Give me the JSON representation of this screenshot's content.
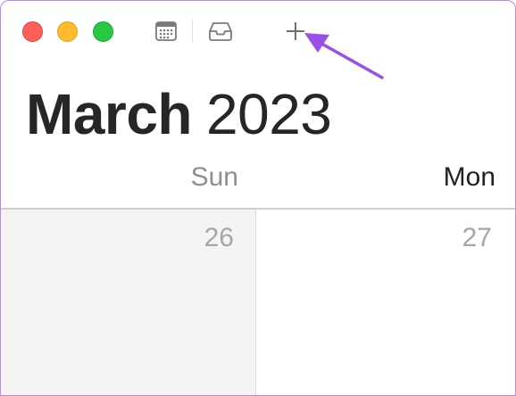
{
  "window": {
    "traffic_lights": {
      "close_color": "#fe5f57",
      "minimize_color": "#febc2e",
      "zoom_color": "#28c840"
    }
  },
  "toolbar": {
    "icons": [
      "calendar-list-icon",
      "inbox-icon",
      "plus-icon"
    ]
  },
  "annotation": {
    "arrow_color": "#9a4fe6",
    "points_to": "add-event-button"
  },
  "header": {
    "month": "March",
    "year": "2023"
  },
  "week": {
    "day_names": [
      "Sun",
      "Mon"
    ],
    "day_numbers": [
      "26",
      "27"
    ]
  },
  "colors": {
    "window_border": "#b98be8",
    "weekend_background": "#f4f4f4"
  }
}
